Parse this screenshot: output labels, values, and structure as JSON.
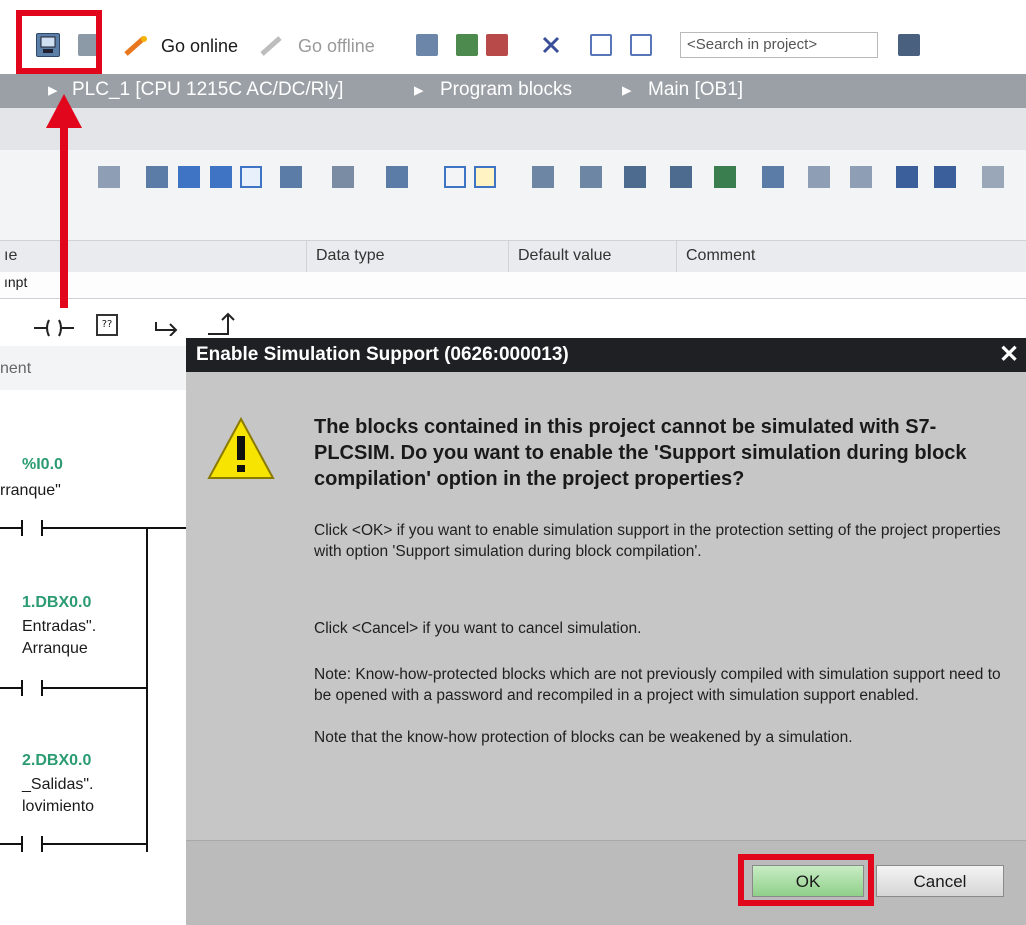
{
  "toolbar": {
    "go_online": "Go online",
    "go_offline": "Go offline",
    "search_placeholder": "<Search in project>"
  },
  "breadcrumb": {
    "device": "PLC_1 [CPU 1215C AC/DC/Rly]",
    "folder": "Program blocks",
    "block": "Main [OB1]",
    "separator": "▸"
  },
  "interface_table": {
    "col_name": "ıe",
    "col_data_type": "Data type",
    "col_default": "Default value",
    "col_comment": "Comment",
    "row_partial": "ınpt"
  },
  "ladder": {
    "comment_label": "nent",
    "contacts": [
      {
        "address": "%I0.0",
        "address_shown": "%I0.0",
        "line1": "rranque\"",
        "line2": ""
      },
      {
        "address": "1.DBX0.0",
        "line1": "Entradas\".",
        "line2": "Arranque"
      },
      {
        "address": "2.DBX0.0",
        "line1": "_Salidas\".",
        "line2": "lovimiento"
      }
    ]
  },
  "dialog": {
    "title": "Enable Simulation Support (0626:000013)",
    "close": "✕",
    "main_text": "The blocks contained in this project cannot be simulated with S7-PLCSIM. Do you want to enable the 'Support simulation during block compilation' option in the project properties?",
    "para1": "Click <OK> if you want to enable simulation support in the protection setting of the project properties with option 'Support simulation during block compilation'.",
    "para2": "Click <Cancel> if you want to cancel simulation.",
    "para3": "Note: Know-how-protected blocks which are not previously compiled with simulation support need to be opened with a password and recompiled in a project with simulation support enabled.",
    "para4": "Note that the know-how protection of blocks can be weakened by a simulation.",
    "ok_label": "OK",
    "cancel_label": "Cancel"
  },
  "colors": {
    "annotation_red": "#e1061b",
    "ok_green": "#8fd08a",
    "title_bar": "#1f2023",
    "ladder_green": "#2b9b72"
  },
  "icons": [
    "start-simulation-icon",
    "download-icon",
    "go-online-icon",
    "go-offline-icon",
    "accessible-devices-icon",
    "warning-icon",
    "search-project-icon"
  ]
}
